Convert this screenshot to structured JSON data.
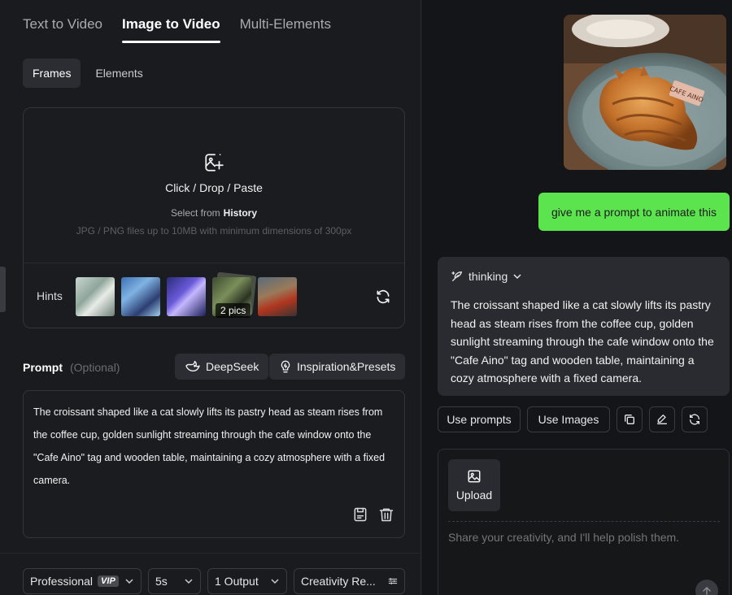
{
  "tabs": [
    {
      "label": "Text to Video",
      "active": false
    },
    {
      "label": "Image to Video",
      "active": true
    },
    {
      "label": "Multi-Elements",
      "active": false
    }
  ],
  "subtabs": [
    {
      "label": "Frames",
      "active": true
    },
    {
      "label": "Elements",
      "active": false
    }
  ],
  "upload": {
    "title": "Click / Drop / Paste",
    "select_prefix": "Select from",
    "select_link": "History",
    "note": "JPG / PNG files up to 10MB with minimum dimensions of 300px"
  },
  "hints": {
    "label": "Hints",
    "badge": "2 pics"
  },
  "prompt": {
    "label": "Prompt",
    "optional": "(Optional)",
    "deepseek_label": "DeepSeek",
    "inspiration_label": "Inspiration&Presets",
    "text": "The croissant shaped like a cat slowly lifts its pastry head as steam rises from the coffee cup, golden sunlight streaming through the cafe window onto the \"Cafe Aino\" tag and wooden table, maintaining a cozy atmosphere with a fixed camera."
  },
  "settings": {
    "mode": "Professional",
    "vip": "VIP",
    "duration": "5s",
    "output": "1 Output",
    "creativity": "Creativity Re..."
  },
  "chat": {
    "user_message": "give me a prompt to animate this",
    "thinking_label": "thinking",
    "assistant_text": "The croissant shaped like a cat slowly lifts its pastry head as steam rises from the coffee cup, golden sunlight streaming through the cafe window onto the \"Cafe Aino\" tag and wooden table, maintaining a cozy atmosphere with a fixed camera.",
    "use_prompts_label": "Use prompts",
    "use_images_label": "Use Images",
    "image_tag_text": "CAFE AINO"
  },
  "composer": {
    "upload_label": "Upload",
    "placeholder": "Share your creativity, and I'll help polish them."
  },
  "colors": {
    "accent_green": "#5ce44e",
    "background": "#1a1b1e",
    "panel": "#2a2b30"
  }
}
